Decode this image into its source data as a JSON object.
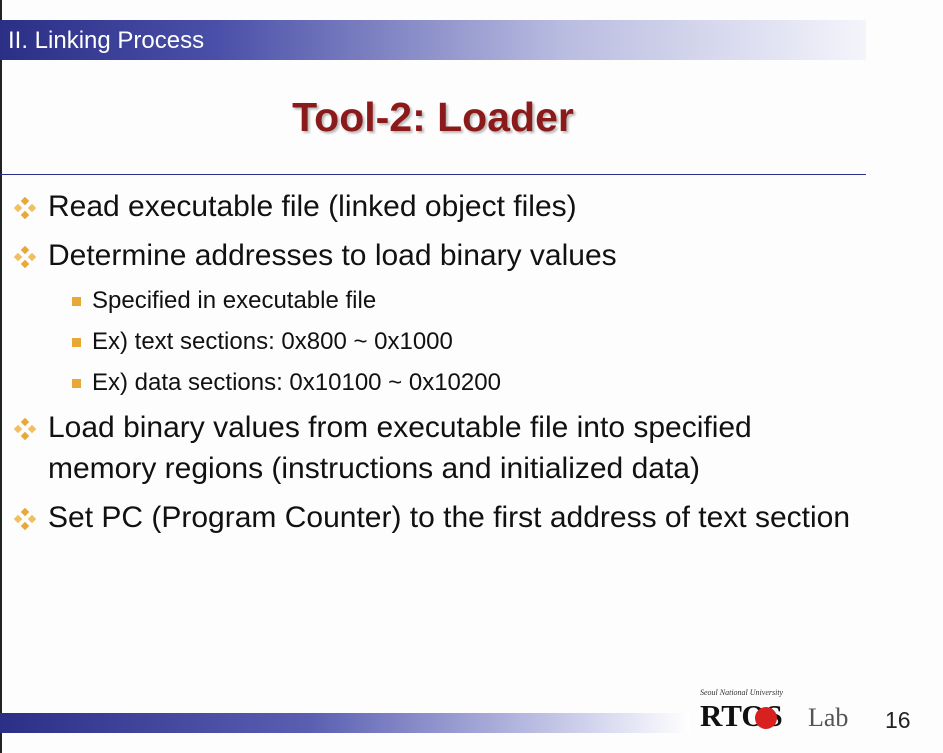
{
  "section": {
    "title": "II. Linking Process"
  },
  "slide": {
    "title": "Tool-2: Loader",
    "page_number": "16"
  },
  "colors": {
    "title": "#8b1a1a",
    "bar": "#2b2f86",
    "bullet_diamond": "#e8a838",
    "sub_bullet": "#e8a838"
  },
  "bullets": [
    {
      "text": "Read executable file (linked object files)"
    },
    {
      "text": "Determine addresses to load binary values",
      "sub": [
        "Specified in executable file",
        "Ex) text sections: 0x800 ~ 0x1000",
        "Ex) data sections: 0x10100 ~ 0x10200"
      ]
    },
    {
      "text": "Load binary values from executable file into specified memory regions (instructions and initialized data)"
    },
    {
      "text": "Set PC (Program Counter) to the first address of text section"
    }
  ],
  "logo": {
    "tagline": "Seoul National University",
    "name": "RTOS",
    "suffix": "Lab"
  }
}
